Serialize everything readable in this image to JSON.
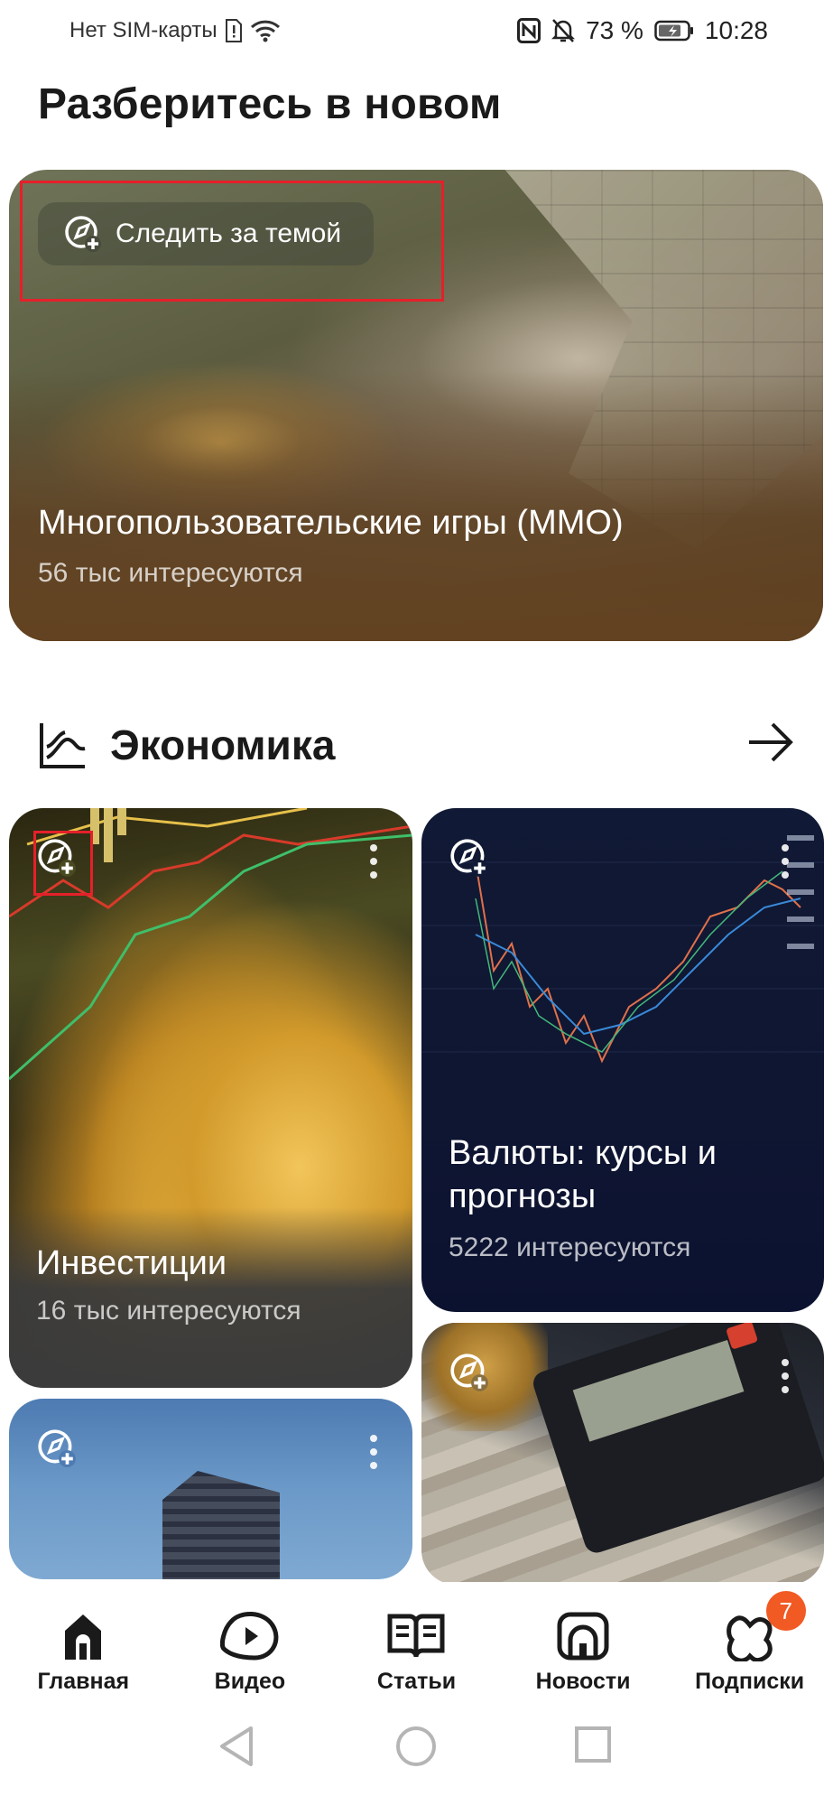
{
  "status_bar": {
    "carrier": "Нет SIM-карты",
    "battery": "73 %",
    "time": "10:28"
  },
  "headline": "Разберитесь в новом",
  "hero": {
    "follow_label": "Следить за темой",
    "title": "Многопользовательские игры (MMO)",
    "subtitle": "56 тыс интересуются"
  },
  "section": {
    "title": "Экономика"
  },
  "cards": [
    {
      "title": "Инвестиции",
      "subtitle": "16 тыс интересуются"
    },
    {
      "title_line1": "Валюты: курсы и",
      "title_line2": "прогнозы",
      "subtitle": "5222 интересуются"
    }
  ],
  "bottom_nav": {
    "items": [
      {
        "label": "Главная",
        "icon": "home-icon"
      },
      {
        "label": "Видео",
        "icon": "video-icon"
      },
      {
        "label": "Статьи",
        "icon": "articles-icon"
      },
      {
        "label": "Новости",
        "icon": "news-icon"
      },
      {
        "label": "Подписки",
        "icon": "subscriptions-icon"
      }
    ],
    "subscriptions_badge": "7"
  },
  "colors": {
    "highlight": "#e5202a",
    "badge": "#f15a22"
  }
}
